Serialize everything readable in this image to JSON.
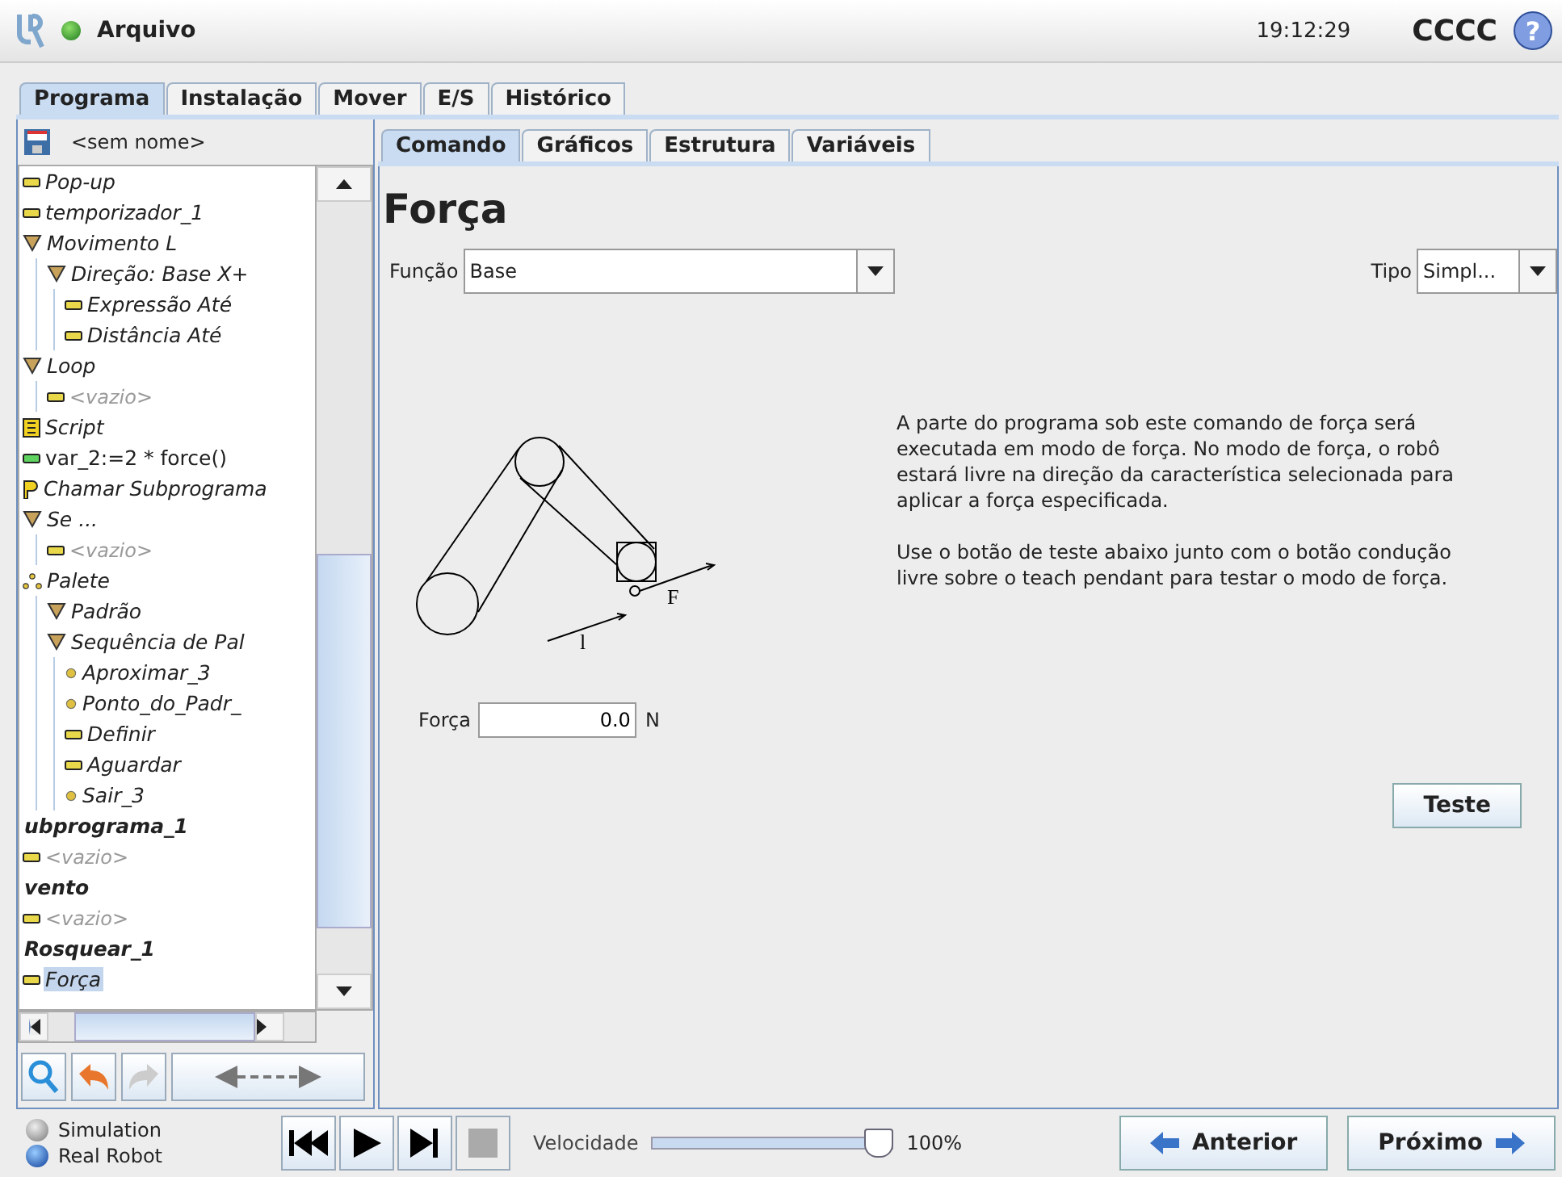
{
  "header": {
    "menu": "Arquivo",
    "time": "19:12:29",
    "robot_name": "CCCC",
    "help": "?"
  },
  "main_tabs": [
    {
      "label": "Programa",
      "selected": true
    },
    {
      "label": "Instalação",
      "selected": false
    },
    {
      "label": "Mover",
      "selected": false
    },
    {
      "label": "E/S",
      "selected": false
    },
    {
      "label": "Histórico",
      "selected": false
    }
  ],
  "program": {
    "name": "<sem nome>",
    "tree": [
      {
        "label": "Pop-up",
        "kind": "command",
        "selected": false
      },
      {
        "label": "temporizador_1",
        "kind": "command",
        "selected": false
      },
      {
        "label": "Movimento L",
        "kind": "folder",
        "selected": false,
        "children": [
          {
            "label": "Direção: Base X+",
            "kind": "folder",
            "selected": false,
            "children": [
              {
                "label": "Expressão Até",
                "kind": "command",
                "selected": false
              },
              {
                "label": "Distância Até",
                "kind": "command",
                "selected": false
              }
            ]
          }
        ]
      },
      {
        "label": "Loop",
        "kind": "folder",
        "selected": false,
        "children": [
          {
            "label": "<vazio>",
            "kind": "empty",
            "selected": false
          }
        ]
      },
      {
        "label": "Script",
        "kind": "script",
        "selected": false
      },
      {
        "label": "var_2:=2 * force()",
        "kind": "assignment",
        "selected": false
      },
      {
        "label": "Chamar Subprograma",
        "kind": "call",
        "selected": false
      },
      {
        "label": "Se ...",
        "kind": "folder",
        "selected": false,
        "children": [
          {
            "label": "<vazio>",
            "kind": "empty",
            "selected": false
          }
        ]
      },
      {
        "label": "Palete",
        "kind": "pallet",
        "selected": false,
        "children": [
          {
            "label": "Padrão",
            "kind": "folder",
            "selected": false
          },
          {
            "label": "Sequência de Pal",
            "kind": "folder",
            "selected": false,
            "children": [
              {
                "label": "Aproximar_3",
                "kind": "waypoint",
                "selected": false
              },
              {
                "label": "Ponto_do_Padr_",
                "kind": "waypoint",
                "selected": false
              },
              {
                "label": "Definir",
                "kind": "command",
                "selected": false
              },
              {
                "label": "Aguardar",
                "kind": "command",
                "selected": false
              },
              {
                "label": "Sair_3",
                "kind": "waypoint",
                "selected": false
              }
            ]
          }
        ]
      },
      {
        "label": "ubprograma_1",
        "kind": "section",
        "selected": false
      },
      {
        "label": "<vazio>",
        "kind": "empty",
        "selected": false
      },
      {
        "label": "vento",
        "kind": "section",
        "selected": false
      },
      {
        "label": "<vazio>",
        "kind": "empty",
        "selected": false
      },
      {
        "label": "Rosquear_1",
        "kind": "section",
        "selected": false
      },
      {
        "label": "Força",
        "kind": "command",
        "selected": true
      }
    ]
  },
  "sub_tabs": [
    {
      "label": "Comando",
      "selected": true
    },
    {
      "label": "Gráficos",
      "selected": false
    },
    {
      "label": "Estrutura",
      "selected": false
    },
    {
      "label": "Variáveis",
      "selected": false
    }
  ],
  "command": {
    "title": "Força",
    "function_label": "Função",
    "function_value": "Base",
    "type_label": "Tipo",
    "type_value": "Simpl...",
    "diagram_labels": [
      "F",
      "l"
    ],
    "force_label": "Força",
    "force_value": "0.0",
    "force_unit": "N",
    "description": [
      "A parte do programa sob este comando de força será executada em modo de força. No modo de força, o robô estará livre na direção da característica selecionada para aplicar a força especificada.",
      "Use o botão de teste abaixo junto com o botão condução livre sobre o teach pendant para testar o modo de força."
    ],
    "test_button": "Teste"
  },
  "footer": {
    "modes": [
      {
        "label": "Simulation",
        "selected": false
      },
      {
        "label": "Real Robot",
        "selected": true
      }
    ],
    "stop_disabled": true,
    "speed_label": "Velocidade",
    "speed": {
      "level": 1.0
    },
    "speed_reading": "100%",
    "previous": "Anterior",
    "next": "Próximo"
  }
}
